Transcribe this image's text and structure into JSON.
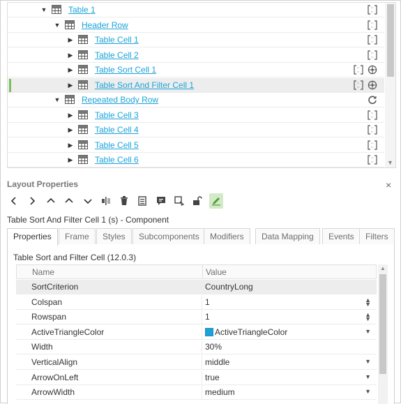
{
  "tree": {
    "rows": [
      {
        "label": "Table 1",
        "level": 0,
        "expanded": true
      },
      {
        "label": "Header Row",
        "level": 1,
        "expanded": true
      },
      {
        "label": "Table Cell 1",
        "level": 2,
        "expanded": false
      },
      {
        "label": "Table Cell 2",
        "level": 2,
        "expanded": false
      },
      {
        "label": "Table Sort Cell 1",
        "level": 2,
        "expanded": false
      },
      {
        "label": "Table Sort And Filter Cell 1",
        "level": 2,
        "expanded": false,
        "selected": true
      },
      {
        "label": "Repeated Body Row",
        "level": 1,
        "expanded": true
      },
      {
        "label": "Table Cell 3",
        "level": 2,
        "expanded": false
      },
      {
        "label": "Table Cell 4",
        "level": 2,
        "expanded": false
      },
      {
        "label": "Table Cell 5",
        "level": 2,
        "expanded": false
      },
      {
        "label": "Table Cell 6",
        "level": 2,
        "expanded": false
      }
    ],
    "icons": [
      "table-icon",
      "bracket-icon",
      "target-icon",
      "refresh-icon"
    ]
  },
  "layout_properties": {
    "title": "Layout Properties",
    "close_glyph": "×",
    "component_title": "Table Sort And Filter Cell 1 (s) - Component",
    "tabs": [
      "Properties",
      "Frame",
      "Styles",
      "Subcomponents",
      "Modifiers",
      "Data Mapping",
      "Events",
      "Filters"
    ],
    "active_tab": "Properties",
    "component_version": "Table Sort and Filter Cell (12.0.3)",
    "grid": {
      "headers": {
        "name": "Name",
        "value": "Value"
      },
      "rows": [
        {
          "name": "SortCriterion",
          "value": "CountryLong",
          "control": "none",
          "selected": true
        },
        {
          "name": "Colspan",
          "value": "1",
          "control": "spinner"
        },
        {
          "name": "Rowspan",
          "value": "1",
          "control": "spinner"
        },
        {
          "name": "ActiveTriangleColor",
          "value": "ActiveTriangleColor",
          "control": "dropdown",
          "swatch": "#1ea0d9"
        },
        {
          "name": "Width",
          "value": "30%",
          "control": "none"
        },
        {
          "name": "VerticalAlign",
          "value": "middle",
          "control": "dropdown"
        },
        {
          "name": "ArrowOnLeft",
          "value": "true",
          "control": "dropdown"
        },
        {
          "name": "ArrowWidth",
          "value": "medium",
          "control": "dropdown"
        }
      ]
    },
    "toolbar": [
      "chevron-left-icon",
      "chevron-right-icon",
      "double-chevron-up-icon",
      "chevron-up-icon",
      "chevron-down-icon",
      "align-icon",
      "trash-icon",
      "document-icon",
      "comment-icon",
      "select-icon",
      "unlock-icon",
      "edit-icon"
    ]
  },
  "colors": {
    "link": "#1aa3d9",
    "selected_marker": "#79c25b",
    "active_tool": "#d4e9c9"
  }
}
